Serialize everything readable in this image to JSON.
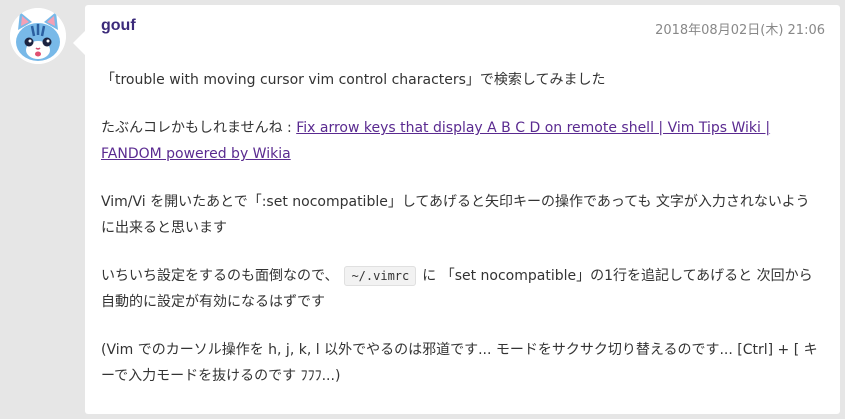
{
  "post": {
    "author": "gouf",
    "timestamp": "2018年08月02日(木) 21:06",
    "p1": "「trouble with moving cursor vim control characters」で検索してみました",
    "p2_prefix": "たぶんコレかもしれませんね : ",
    "p2_link": "Fix arrow keys that display A B C D on remote shell | Vim Tips Wiki | FANDOM powered by Wikia",
    "p3": "Vim/Vi を開いたあとで「:set nocompatible」してあげると矢印キーの操作であっても 文字が入力されないように出来ると思います",
    "p4_prefix": "いちいち設定をするのも面倒なので、",
    "p4_code": "~/.vimrc",
    "p4_suffix": "に 「set nocompatible」の1行を追記してあげると 次回から自動的に設定が有効になるはずです",
    "p5": "(Vim でのカーソル操作を h, j, k, l 以外でやるのは邪道です... モードをサクサク切り替えるのです... [Ctrl] + [ キーで入力モードを抜けるのです ﾌﾌﾌ...)"
  },
  "avatar": {
    "icon": "cat-avatar-icon",
    "colors": {
      "fur": "#78b9e8",
      "stripe": "#2b5fa0"
    }
  }
}
